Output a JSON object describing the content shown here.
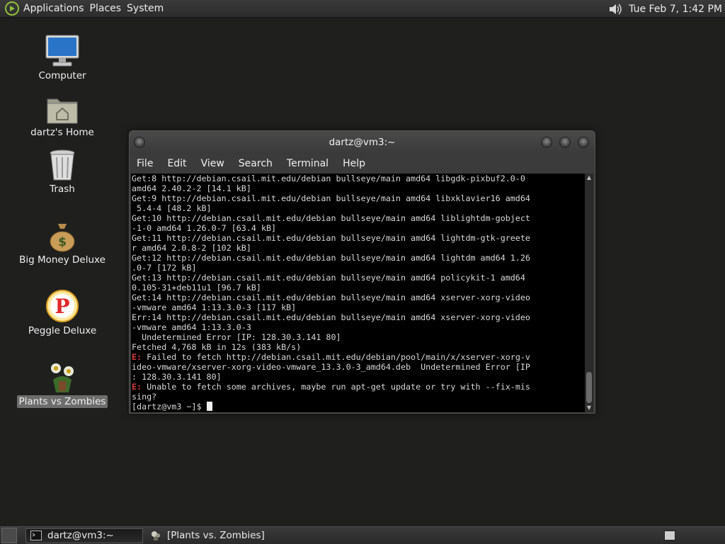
{
  "top_panel": {
    "menus": [
      "Applications",
      "Places",
      "System"
    ],
    "clock": "Tue Feb  7,  1:42 PM"
  },
  "desktop": {
    "icons": [
      {
        "label": "Computer",
        "icon": "computer-icon"
      },
      {
        "label": "dartz's Home",
        "icon": "home-folder-icon"
      },
      {
        "label": "Trash",
        "icon": "trash-icon"
      },
      {
        "label": "Big Money Deluxe",
        "icon": "money-bag-icon"
      },
      {
        "label": "Peggle Deluxe",
        "icon": "peggle-icon"
      },
      {
        "label": "Plants vs Zombies",
        "icon": "plants-vs-zombies-icon"
      }
    ]
  },
  "terminal": {
    "title": "dartz@vm3:~",
    "menu": [
      "File",
      "Edit",
      "View",
      "Search",
      "Terminal",
      "Help"
    ],
    "lines": [
      "Get:8 http://debian.csail.mit.edu/debian bullseye/main amd64 libgdk-pixbuf2.0-0",
      "amd64 2.40.2-2 [14.1 kB]",
      "Get:9 http://debian.csail.mit.edu/debian bullseye/main amd64 libxklavier16 amd64",
      " 5.4-4 [48.2 kB]",
      "Get:10 http://debian.csail.mit.edu/debian bullseye/main amd64 liblightdm-gobject",
      "-1-0 amd64 1.26.0-7 [63.4 kB]",
      "Get:11 http://debian.csail.mit.edu/debian bullseye/main amd64 lightdm-gtk-greete",
      "r amd64 2.0.8-2 [102 kB]",
      "Get:12 http://debian.csail.mit.edu/debian bullseye/main amd64 lightdm amd64 1.26",
      ".0-7 [172 kB]",
      "Get:13 http://debian.csail.mit.edu/debian bullseye/main amd64 policykit-1 amd64",
      "0.105-31+deb11u1 [96.7 kB]",
      "Get:14 http://debian.csail.mit.edu/debian bullseye/main amd64 xserver-xorg-video",
      "-vmware amd64 1:13.3.0-3 [117 kB]",
      "Err:14 http://debian.csail.mit.edu/debian bullseye/main amd64 xserver-xorg-video",
      "-vmware amd64 1:13.3.0-3",
      "  Undetermined Error [IP: 128.30.3.141 80]",
      "Fetched 4,768 kB in 12s (383 kB/s)"
    ],
    "error_prefix": "E:",
    "error1_lines": [
      " Failed to fetch http://debian.csail.mit.edu/debian/pool/main/x/xserver-xorg-v",
      "ideo-vmware/xserver-xorg-video-vmware_13.3.0-3_amd64.deb  Undetermined Error [IP",
      ": 128.30.3.141 80]"
    ],
    "error2_lines": [
      " Unable to fetch some archives, maybe run apt-get update or try with --fix-mis",
      "sing?"
    ],
    "prompt": "[dartz@vm3 ~]$ "
  },
  "taskbar": {
    "tasks": [
      {
        "label": "dartz@vm3:~",
        "active": true
      },
      {
        "label": "[Plants vs. Zombies]",
        "active": false
      }
    ]
  }
}
